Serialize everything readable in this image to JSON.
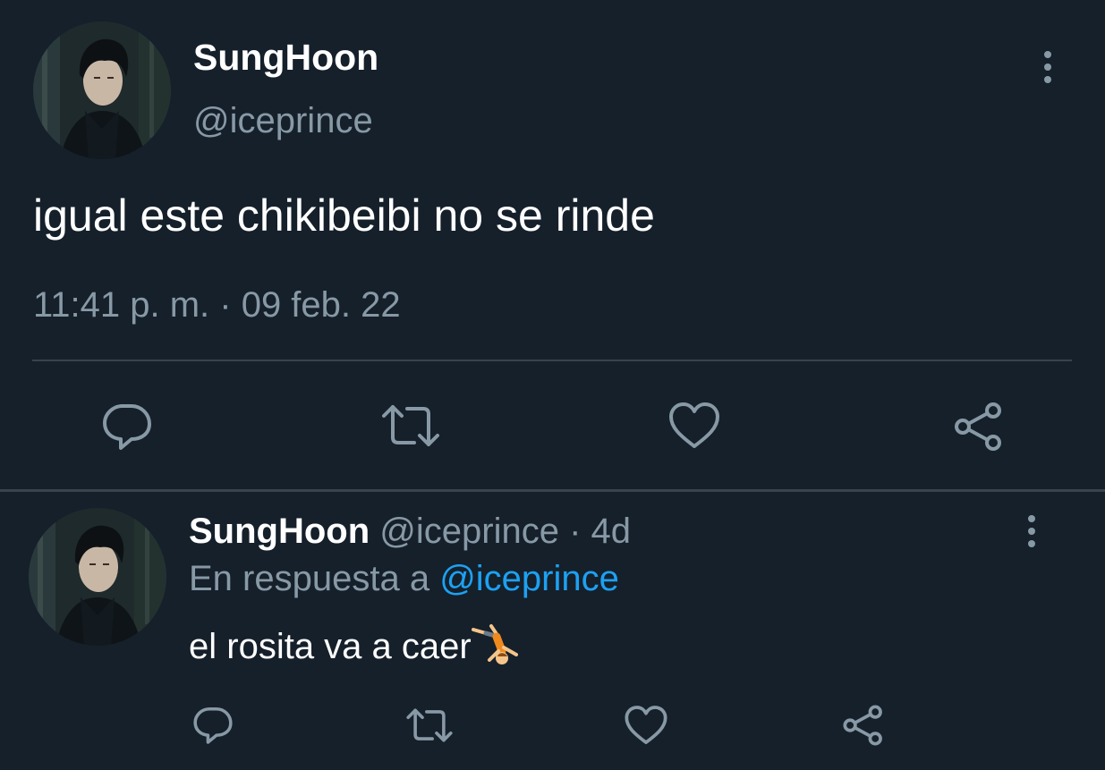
{
  "main_tweet": {
    "display_name": "SungHoon",
    "handle": "@iceprince",
    "text": "igual este chikibeibi no se rinde",
    "timestamp": "11:41 p. m. · 09 feb. 22",
    "actions": {
      "reply_icon": "reply-icon",
      "retweet_icon": "retweet-icon",
      "like_icon": "heart-icon",
      "share_icon": "share-icon"
    },
    "more_icon": "more-vertical-icon"
  },
  "reply_tweet": {
    "display_name": "SungHoon",
    "handle": "@iceprince",
    "separator": " · ",
    "age": "4d",
    "in_reply_prefix": "En respuesta a ",
    "in_reply_handle": "@iceprince",
    "text": "el rosita va a caer",
    "emoji": "person-doing-cartwheel-emoji",
    "actions": {
      "reply_icon": "reply-icon",
      "retweet_icon": "retweet-icon",
      "like_icon": "heart-icon",
      "share_icon": "share-icon"
    },
    "more_icon": "more-vertical-icon"
  },
  "colors": {
    "background": "#15202b",
    "primary_text": "#ffffff",
    "secondary_text": "#8899a6",
    "link": "#1da1f2",
    "divider": "#38444d"
  }
}
